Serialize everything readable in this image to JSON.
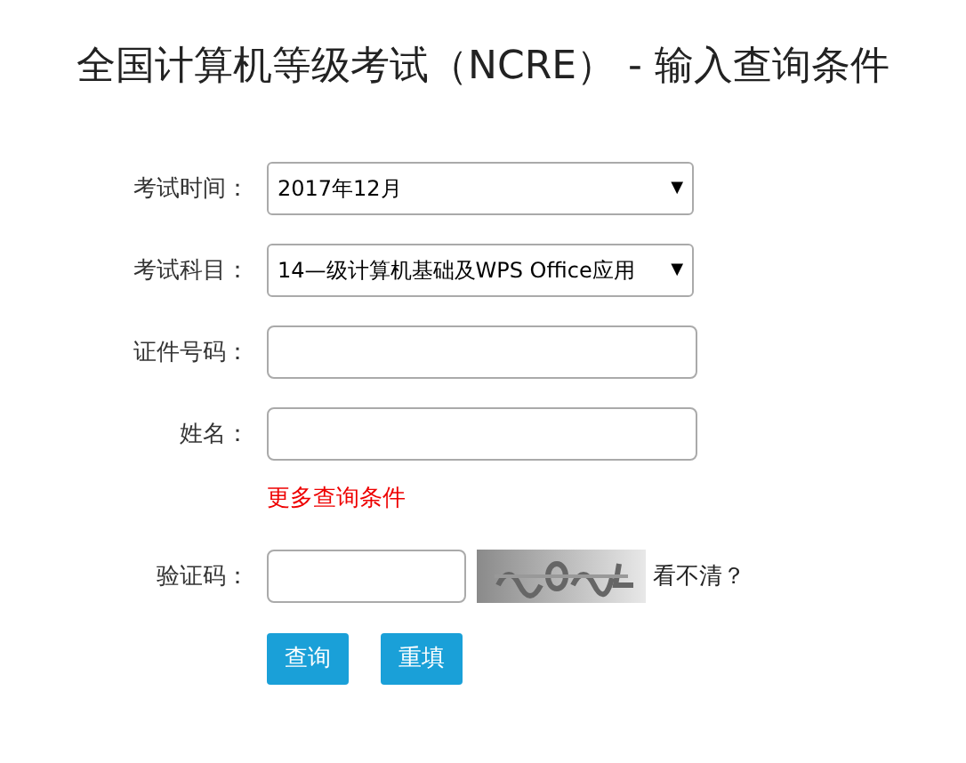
{
  "title": "全国计算机等级考试（NCRE） - 输入查询条件",
  "fields": [
    {
      "kind": "select",
      "label": "考试时间：",
      "value": "2017年12月",
      "caret": "▼"
    },
    {
      "kind": "select",
      "label": "考试科目：",
      "value": "14—级计算机基础及WPS Office应用",
      "caret": "▼"
    },
    {
      "kind": "input",
      "label": "证件号码："
    },
    {
      "kind": "input",
      "label": "姓名："
    }
  ],
  "more_link": "更多查询条件",
  "captcha": {
    "label": "验证码：",
    "refresh_link": "看不清？"
  },
  "buttons": [
    "查询",
    "重填"
  ]
}
